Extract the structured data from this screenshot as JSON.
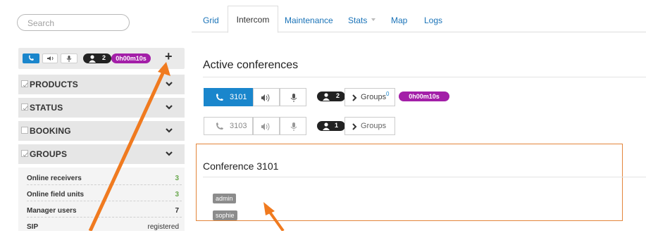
{
  "search": {
    "placeholder": "Search"
  },
  "sidebar_call": {
    "count": "2",
    "timer": "0h00m10s",
    "add_label": "+"
  },
  "accordions": [
    {
      "label": "PRODUCTS",
      "checked": true
    },
    {
      "label": "STATUS",
      "checked": true
    },
    {
      "label": "BOOKING",
      "checked": false
    },
    {
      "label": "GROUPS",
      "checked": true
    }
  ],
  "stats": [
    {
      "label": "Online receivers",
      "value": "3",
      "color": "#6aa84f"
    },
    {
      "label": "Online field units",
      "value": "3",
      "color": "#6aa84f"
    },
    {
      "label": "Manager users",
      "value": "7",
      "color": "#333333"
    },
    {
      "label": "SIP",
      "value": "registered",
      "color": "#333333"
    }
  ],
  "tabs": [
    {
      "label": "Grid",
      "active": false
    },
    {
      "label": "Intercom",
      "active": true
    },
    {
      "label": "Maintenance",
      "active": false
    },
    {
      "label": "Stats",
      "active": false,
      "dropdown": true
    },
    {
      "label": "Map",
      "active": false
    },
    {
      "label": "Logs",
      "active": false
    }
  ],
  "active_title": "Active conferences",
  "conferences": [
    {
      "number": "3101",
      "count": "2",
      "groups_label": "Groups",
      "groups_count": "0",
      "timer": "0h00m10s",
      "active": true
    },
    {
      "number": "3103",
      "count": "1",
      "groups_label": "Groups",
      "active": false
    }
  ],
  "detail": {
    "title": "Conference 3101",
    "members": [
      "admin",
      "sophie"
    ]
  },
  "colors": {
    "accent": "#1a86cc",
    "timer": "#a31fa8",
    "annotation": "#f07a1f",
    "link": "#1a73b8"
  }
}
